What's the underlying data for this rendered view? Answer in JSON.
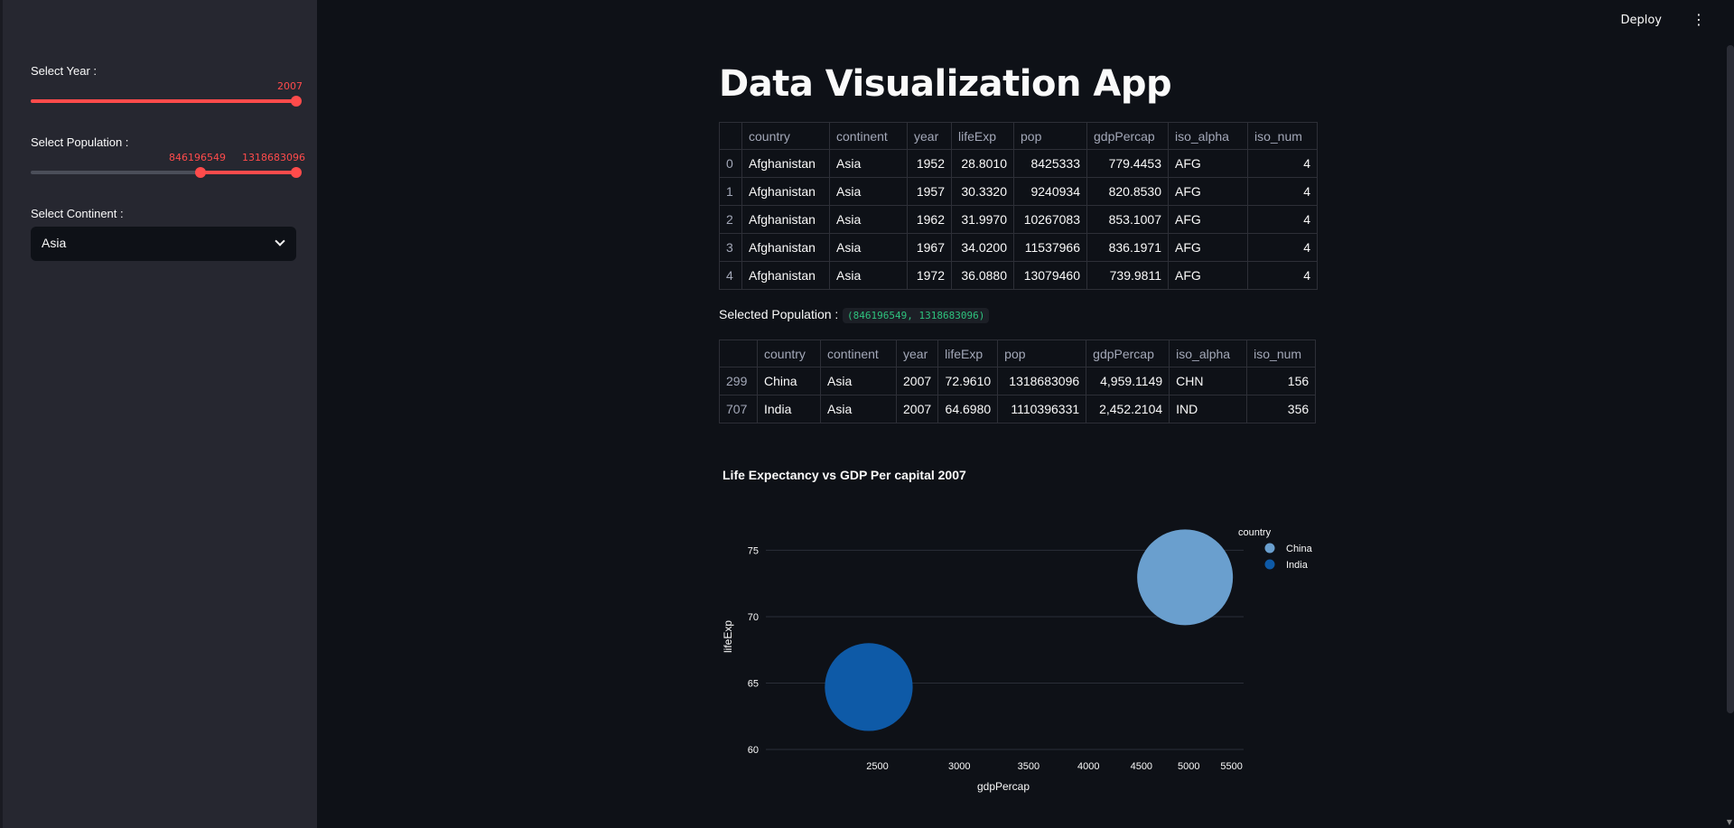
{
  "topbar": {
    "deploy_label": "Deploy",
    "menu_icon": "kebab-icon"
  },
  "sidebar": {
    "year_label": "Select Year :",
    "year_value": "2007",
    "population_label": "Select Population :",
    "population_min": "846196549",
    "population_max": "1318683096",
    "continent_label": "Select Continent :",
    "continent_value": "Asia"
  },
  "main": {
    "title": "Data Visualization App",
    "table1": {
      "headers": [
        "",
        "country",
        "continent",
        "year",
        "lifeExp",
        "pop",
        "gdpPercap",
        "iso_alpha",
        "iso_num"
      ],
      "rows": [
        [
          "0",
          "Afghanistan",
          "Asia",
          "1952",
          "28.8010",
          "8425333",
          "779.4453",
          "AFG",
          "4"
        ],
        [
          "1",
          "Afghanistan",
          "Asia",
          "1957",
          "30.3320",
          "9240934",
          "820.8530",
          "AFG",
          "4"
        ],
        [
          "2",
          "Afghanistan",
          "Asia",
          "1962",
          "31.9970",
          "10267083",
          "853.1007",
          "AFG",
          "4"
        ],
        [
          "3",
          "Afghanistan",
          "Asia",
          "1967",
          "34.0200",
          "11537966",
          "836.1971",
          "AFG",
          "4"
        ],
        [
          "4",
          "Afghanistan",
          "Asia",
          "1972",
          "36.0880",
          "13079460",
          "739.9811",
          "AFG",
          "4"
        ]
      ]
    },
    "selected_population_label": "Selected Population :",
    "selected_population_value": "(846196549, 1318683096)",
    "table2": {
      "headers": [
        "",
        "country",
        "continent",
        "year",
        "lifeExp",
        "pop",
        "gdpPercap",
        "iso_alpha",
        "iso_num"
      ],
      "rows": [
        [
          "299",
          "China",
          "Asia",
          "2007",
          "72.9610",
          "1318683096",
          "4,959.1149",
          "CHN",
          "156"
        ],
        [
          "707",
          "India",
          "Asia",
          "2007",
          "64.6980",
          "1110396331",
          "2,452.2104",
          "IND",
          "356"
        ]
      ]
    }
  },
  "chart_data": {
    "type": "scatter",
    "title": "Life Expectancy vs GDP Per capital 2007",
    "xlabel": "gdpPercap",
    "ylabel": "lifeExp",
    "xlim": [
      1950,
      5650
    ],
    "ylim": [
      60,
      77
    ],
    "x_ticks": [
      2500,
      3000,
      3500,
      4000,
      4500,
      5000,
      5500
    ],
    "x_log": true,
    "y_ticks": [
      60,
      65,
      70,
      75
    ],
    "grid": true,
    "legend_title": "country",
    "legend_position": "top-right",
    "series": [
      {
        "name": "China",
        "x": 4959.1149,
        "y": 72.961,
        "size": 1318683096,
        "color": "#6a9fce"
      },
      {
        "name": "India",
        "x": 2452.2104,
        "y": 64.698,
        "size": 1110396331,
        "color": "#0e5aa7"
      }
    ]
  }
}
